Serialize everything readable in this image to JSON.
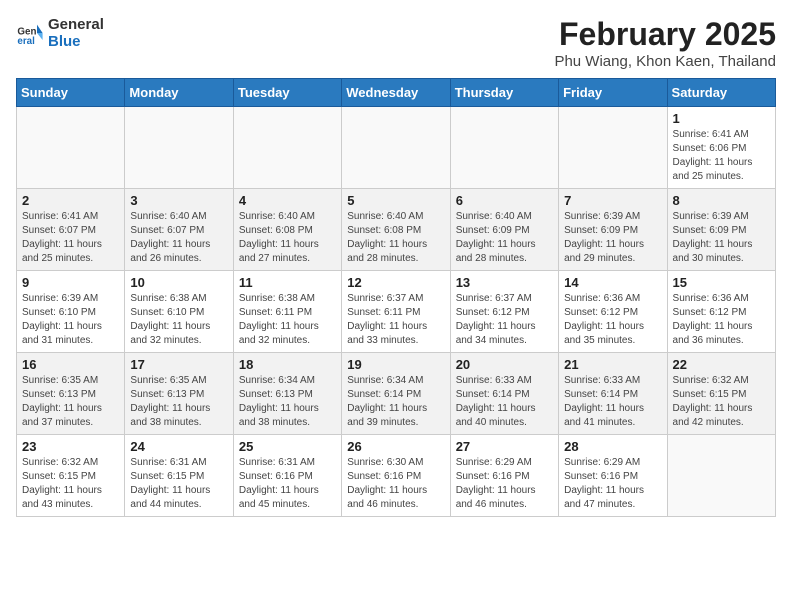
{
  "header": {
    "logo_line1": "General",
    "logo_line2": "Blue",
    "month_year": "February 2025",
    "location": "Phu Wiang, Khon Kaen, Thailand"
  },
  "weekdays": [
    "Sunday",
    "Monday",
    "Tuesday",
    "Wednesday",
    "Thursday",
    "Friday",
    "Saturday"
  ],
  "weeks": [
    [
      {
        "day": "",
        "info": ""
      },
      {
        "day": "",
        "info": ""
      },
      {
        "day": "",
        "info": ""
      },
      {
        "day": "",
        "info": ""
      },
      {
        "day": "",
        "info": ""
      },
      {
        "day": "",
        "info": ""
      },
      {
        "day": "1",
        "info": "Sunrise: 6:41 AM\nSunset: 6:06 PM\nDaylight: 11 hours\nand 25 minutes."
      }
    ],
    [
      {
        "day": "2",
        "info": "Sunrise: 6:41 AM\nSunset: 6:07 PM\nDaylight: 11 hours\nand 25 minutes."
      },
      {
        "day": "3",
        "info": "Sunrise: 6:40 AM\nSunset: 6:07 PM\nDaylight: 11 hours\nand 26 minutes."
      },
      {
        "day": "4",
        "info": "Sunrise: 6:40 AM\nSunset: 6:08 PM\nDaylight: 11 hours\nand 27 minutes."
      },
      {
        "day": "5",
        "info": "Sunrise: 6:40 AM\nSunset: 6:08 PM\nDaylight: 11 hours\nand 28 minutes."
      },
      {
        "day": "6",
        "info": "Sunrise: 6:40 AM\nSunset: 6:09 PM\nDaylight: 11 hours\nand 28 minutes."
      },
      {
        "day": "7",
        "info": "Sunrise: 6:39 AM\nSunset: 6:09 PM\nDaylight: 11 hours\nand 29 minutes."
      },
      {
        "day": "8",
        "info": "Sunrise: 6:39 AM\nSunset: 6:09 PM\nDaylight: 11 hours\nand 30 minutes."
      }
    ],
    [
      {
        "day": "9",
        "info": "Sunrise: 6:39 AM\nSunset: 6:10 PM\nDaylight: 11 hours\nand 31 minutes."
      },
      {
        "day": "10",
        "info": "Sunrise: 6:38 AM\nSunset: 6:10 PM\nDaylight: 11 hours\nand 32 minutes."
      },
      {
        "day": "11",
        "info": "Sunrise: 6:38 AM\nSunset: 6:11 PM\nDaylight: 11 hours\nand 32 minutes."
      },
      {
        "day": "12",
        "info": "Sunrise: 6:37 AM\nSunset: 6:11 PM\nDaylight: 11 hours\nand 33 minutes."
      },
      {
        "day": "13",
        "info": "Sunrise: 6:37 AM\nSunset: 6:12 PM\nDaylight: 11 hours\nand 34 minutes."
      },
      {
        "day": "14",
        "info": "Sunrise: 6:36 AM\nSunset: 6:12 PM\nDaylight: 11 hours\nand 35 minutes."
      },
      {
        "day": "15",
        "info": "Sunrise: 6:36 AM\nSunset: 6:12 PM\nDaylight: 11 hours\nand 36 minutes."
      }
    ],
    [
      {
        "day": "16",
        "info": "Sunrise: 6:35 AM\nSunset: 6:13 PM\nDaylight: 11 hours\nand 37 minutes."
      },
      {
        "day": "17",
        "info": "Sunrise: 6:35 AM\nSunset: 6:13 PM\nDaylight: 11 hours\nand 38 minutes."
      },
      {
        "day": "18",
        "info": "Sunrise: 6:34 AM\nSunset: 6:13 PM\nDaylight: 11 hours\nand 38 minutes."
      },
      {
        "day": "19",
        "info": "Sunrise: 6:34 AM\nSunset: 6:14 PM\nDaylight: 11 hours\nand 39 minutes."
      },
      {
        "day": "20",
        "info": "Sunrise: 6:33 AM\nSunset: 6:14 PM\nDaylight: 11 hours\nand 40 minutes."
      },
      {
        "day": "21",
        "info": "Sunrise: 6:33 AM\nSunset: 6:14 PM\nDaylight: 11 hours\nand 41 minutes."
      },
      {
        "day": "22",
        "info": "Sunrise: 6:32 AM\nSunset: 6:15 PM\nDaylight: 11 hours\nand 42 minutes."
      }
    ],
    [
      {
        "day": "23",
        "info": "Sunrise: 6:32 AM\nSunset: 6:15 PM\nDaylight: 11 hours\nand 43 minutes."
      },
      {
        "day": "24",
        "info": "Sunrise: 6:31 AM\nSunset: 6:15 PM\nDaylight: 11 hours\nand 44 minutes."
      },
      {
        "day": "25",
        "info": "Sunrise: 6:31 AM\nSunset: 6:16 PM\nDaylight: 11 hours\nand 45 minutes."
      },
      {
        "day": "26",
        "info": "Sunrise: 6:30 AM\nSunset: 6:16 PM\nDaylight: 11 hours\nand 46 minutes."
      },
      {
        "day": "27",
        "info": "Sunrise: 6:29 AM\nSunset: 6:16 PM\nDaylight: 11 hours\nand 46 minutes."
      },
      {
        "day": "28",
        "info": "Sunrise: 6:29 AM\nSunset: 6:16 PM\nDaylight: 11 hours\nand 47 minutes."
      },
      {
        "day": "",
        "info": ""
      }
    ]
  ]
}
